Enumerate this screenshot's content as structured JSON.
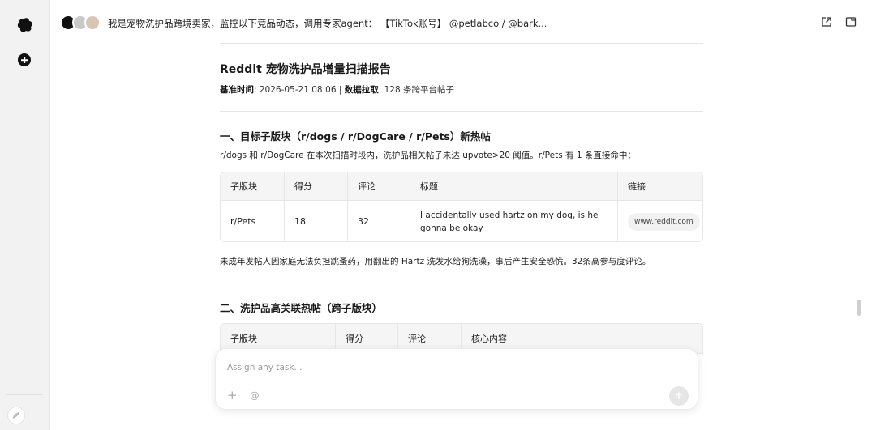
{
  "header": {
    "title": "我是宠物洗护品跨境卖家，监控以下竞品动态，调用专家agent： 【TikTok账号】 @petlabco / @bark..."
  },
  "report": {
    "title": "Reddit 宠物洗护品增量扫描报告",
    "meta": {
      "time_label": "基准时间",
      "time_value": ": 2026-05-21 08:06 | ",
      "data_label": "数据拉取",
      "data_value": ": 128 条跨平台帖子"
    },
    "section1": {
      "heading": "一、目标子版块（r/dogs / r/DogCare / r/Pets）新热帖",
      "intro": "r/dogs 和 r/DogCare 在本次扫描时段内，洗护品相关帖子未达 upvote>20 阈值。r/Pets 有 1 条直接命中：",
      "table": {
        "headers": [
          "子版块",
          "得分",
          "评论",
          "标题",
          "链接"
        ],
        "row": {
          "subreddit": "r/Pets",
          "score": "18",
          "comments": "32",
          "title": "I accidentally used hartz on my dog, is he gonna be okay",
          "link": "www.reddit.com"
        }
      },
      "summary": "未成年发帖人因家庭无法负担跳蚤药，用翻出的 Hartz 洗发水给狗洗澡，事后产生安全恐慌。32条高参与度评论。"
    },
    "section2": {
      "heading": "二、洗护品高关联热帖（跨子版块）",
      "table": {
        "headers": [
          "子版块",
          "得分",
          "评论",
          "核心内容"
        ]
      }
    }
  },
  "composer": {
    "placeholder": "Assign any task...",
    "add_glyph": "+",
    "at_glyph": "@"
  }
}
